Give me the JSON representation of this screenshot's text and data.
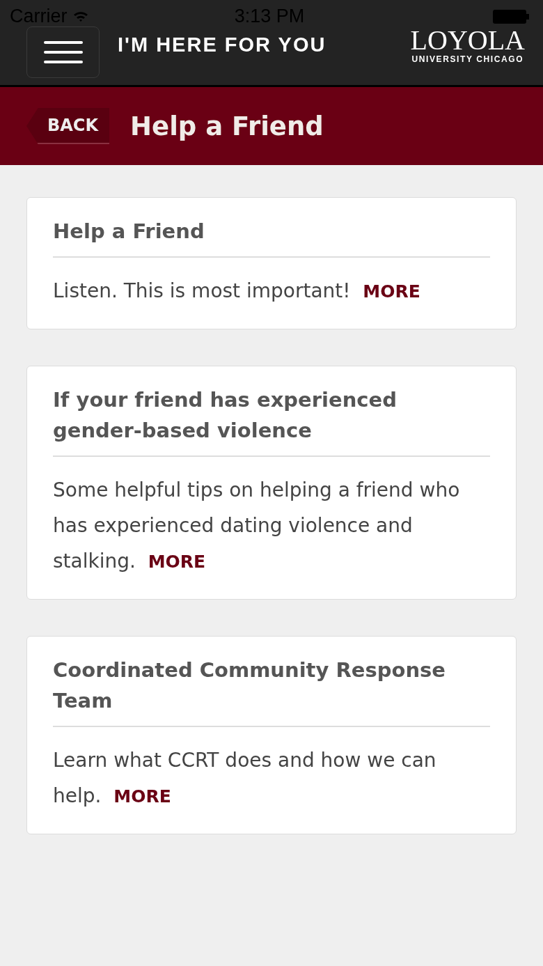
{
  "status_bar": {
    "carrier": "Carrier",
    "time": "3:13 PM"
  },
  "header": {
    "title": "I'M HERE FOR YOU",
    "logo": {
      "name": "LOYOLA",
      "subtitle": "UNIVERSITY CHICAGO"
    }
  },
  "nav_bar": {
    "back": "BACK",
    "title": "Help a Friend"
  },
  "cards": [
    {
      "title": "Help a Friend",
      "body": "Listen. This is most important!",
      "link": "MORE"
    },
    {
      "title": "If your friend has experienced gender-based violence",
      "body": "Some helpful tips on helping a friend who has experienced dating violence and stalking.",
      "link": "MORE"
    },
    {
      "title": "Coordinated Community Response Team",
      "body": "Learn what CCRT does and how we can help.",
      "link": "MORE"
    }
  ]
}
